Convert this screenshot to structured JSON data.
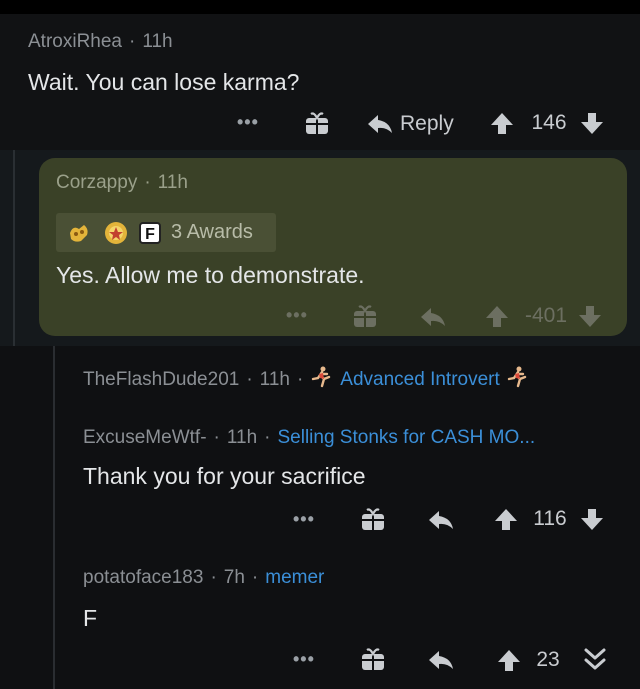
{
  "comment1": {
    "username": "AtroxiRhea",
    "time": "11h",
    "text": "Wait. You can lose karma?",
    "more": "•••",
    "reply_label": "Reply",
    "score": "146"
  },
  "comment2": {
    "username": "Corzappy",
    "time": "11h",
    "awards_label": "3 Awards",
    "award_f": "F",
    "text": "Yes. Allow me to demonstrate.",
    "more": "•••",
    "score": "-401"
  },
  "comment3": {
    "username": "TheFlashDude201",
    "time": "11h",
    "flair": "Advanced Introvert"
  },
  "comment4": {
    "username": "ExcuseMeWtf-",
    "time": "11h",
    "flair": "Selling Stonks for CASH MO...",
    "text": "Thank you for your sacrifice",
    "more": "•••",
    "score": "116"
  },
  "comment5": {
    "username": "potatoface183",
    "time": "7h",
    "flair": "memer",
    "text": "F",
    "more": "•••",
    "score": "23"
  },
  "colors": {
    "background": "#0f1012",
    "highlight_card": "#3a4127",
    "flair_blue": "#3b8fd8"
  },
  "icons": [
    "gift-icon",
    "reply-arrow-icon",
    "upvote-icon",
    "downvote-icon",
    "collapse-chevron-icon",
    "runner-emoji-icon",
    "award-icon"
  ]
}
